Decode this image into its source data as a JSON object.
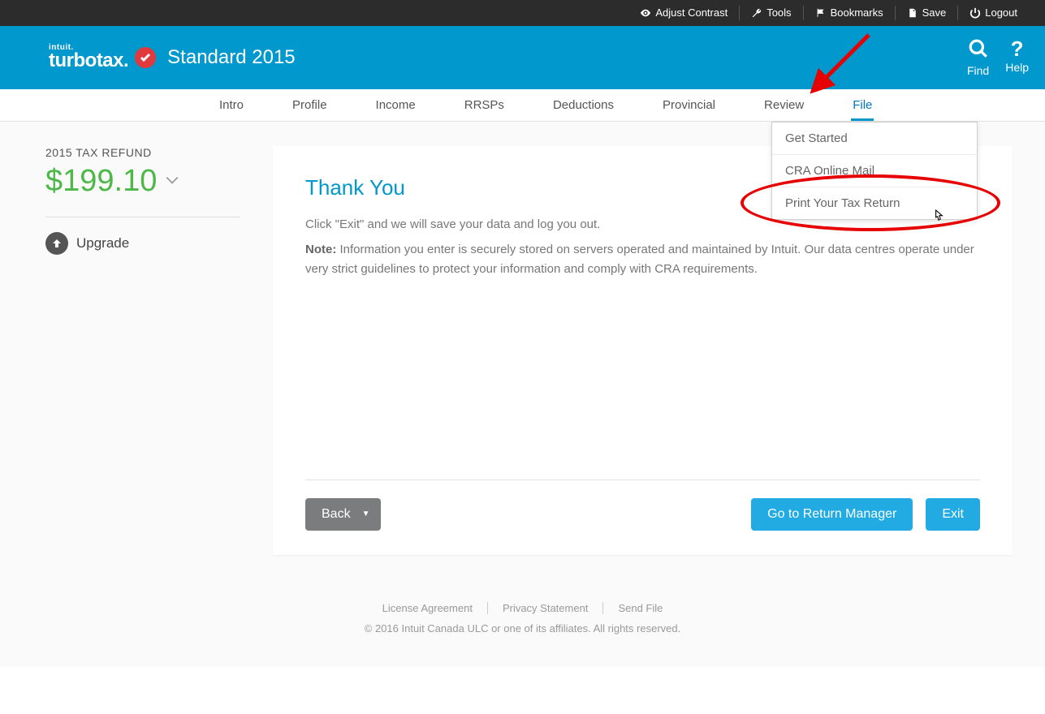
{
  "topbar": {
    "contrast": "Adjust Contrast",
    "tools": "Tools",
    "bookmarks": "Bookmarks",
    "save": "Save",
    "logout": "Logout"
  },
  "header": {
    "brand_parent": "intuit.",
    "brand_name": "turbotax.",
    "product": "Standard 2015",
    "find": "Find",
    "help": "Help"
  },
  "nav": {
    "items": [
      "Intro",
      "Profile",
      "Income",
      "RRSPs",
      "Deductions",
      "Provincial",
      "Review",
      "File"
    ]
  },
  "dropdown": {
    "items": [
      "Get Started",
      "CRA Online Mail",
      "Print Your Tax Return"
    ]
  },
  "sidebar": {
    "refund_label": "2015 TAX REFUND",
    "refund_amount": "$199.10",
    "upgrade": "Upgrade"
  },
  "main": {
    "title": "Thank You",
    "line1": "Click \"Exit\" and we will save your data and log you out.",
    "note_label": "Note:",
    "note_text": " Information you enter is securely stored on servers operated and maintained by Intuit. Our data centres operate under very strict guidelines to protect your information and comply with CRA requirements.",
    "back": "Back",
    "return_manager": "Go to Return Manager",
    "exit": "Exit"
  },
  "footer": {
    "links": [
      "License Agreement",
      "Privacy Statement",
      "Send File"
    ],
    "copyright": "© 2016 Intuit Canada ULC or one of its affiliates. All rights reserved."
  }
}
